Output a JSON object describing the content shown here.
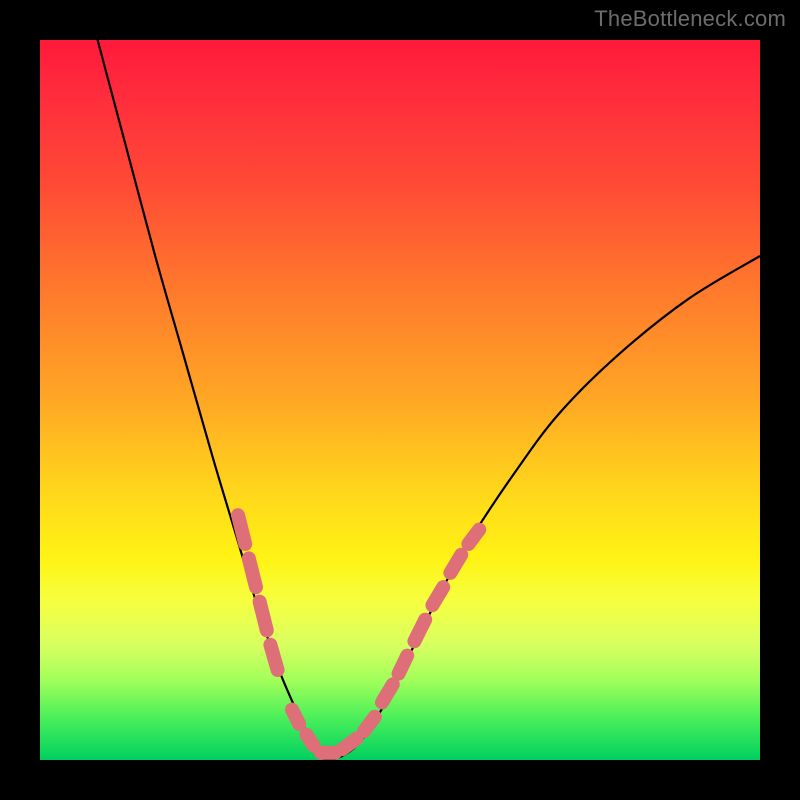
{
  "watermark": "TheBottleneck.com",
  "chart_data": {
    "type": "line",
    "title": "",
    "xlabel": "",
    "ylabel": "",
    "xlim": [
      0,
      100
    ],
    "ylim": [
      0,
      100
    ],
    "grid": false,
    "legend_position": "none",
    "series": [
      {
        "name": "bottleneck-curve",
        "color": "#000000",
        "x": [
          8,
          12,
          16,
          20,
          24,
          27,
          30,
          33,
          36,
          38,
          40,
          44,
          48,
          52,
          56,
          60,
          66,
          72,
          80,
          90,
          100
        ],
        "y": [
          100,
          85,
          70,
          56,
          42,
          32,
          22,
          13,
          6,
          2,
          0,
          2,
          8,
          16,
          24,
          31,
          40,
          48,
          56,
          64,
          70
        ]
      }
    ],
    "overlay_segments": {
      "name": "highlight-dashes",
      "color": "#de6e78",
      "segments": [
        {
          "x1": 27.5,
          "y1": 34,
          "x2": 28.5,
          "y2": 30
        },
        {
          "x1": 29.0,
          "y1": 28,
          "x2": 30.0,
          "y2": 24
        },
        {
          "x1": 30.5,
          "y1": 22,
          "x2": 31.5,
          "y2": 18
        },
        {
          "x1": 32.0,
          "y1": 16,
          "x2": 33.0,
          "y2": 12.5
        },
        {
          "x1": 35.0,
          "y1": 7,
          "x2": 36.0,
          "y2": 5
        },
        {
          "x1": 37.0,
          "y1": 3.5,
          "x2": 38.0,
          "y2": 2
        },
        {
          "x1": 39.0,
          "y1": 1,
          "x2": 41.0,
          "y2": 1
        },
        {
          "x1": 42.0,
          "y1": 1.5,
          "x2": 44.0,
          "y2": 3
        },
        {
          "x1": 45.0,
          "y1": 4,
          "x2": 46.5,
          "y2": 6
        },
        {
          "x1": 47.5,
          "y1": 8,
          "x2": 49.0,
          "y2": 10.5
        },
        {
          "x1": 49.8,
          "y1": 12,
          "x2": 51.0,
          "y2": 14.5
        },
        {
          "x1": 52.0,
          "y1": 16.5,
          "x2": 53.5,
          "y2": 19.5
        },
        {
          "x1": 54.5,
          "y1": 21.5,
          "x2": 56.0,
          "y2": 24
        },
        {
          "x1": 57.0,
          "y1": 26,
          "x2": 58.5,
          "y2": 28.5
        },
        {
          "x1": 59.5,
          "y1": 30,
          "x2": 61.0,
          "y2": 32
        }
      ]
    },
    "background_gradient": {
      "top": "#ff1a3a",
      "mid": "#ffd41c",
      "bottom": "#00d060"
    }
  }
}
